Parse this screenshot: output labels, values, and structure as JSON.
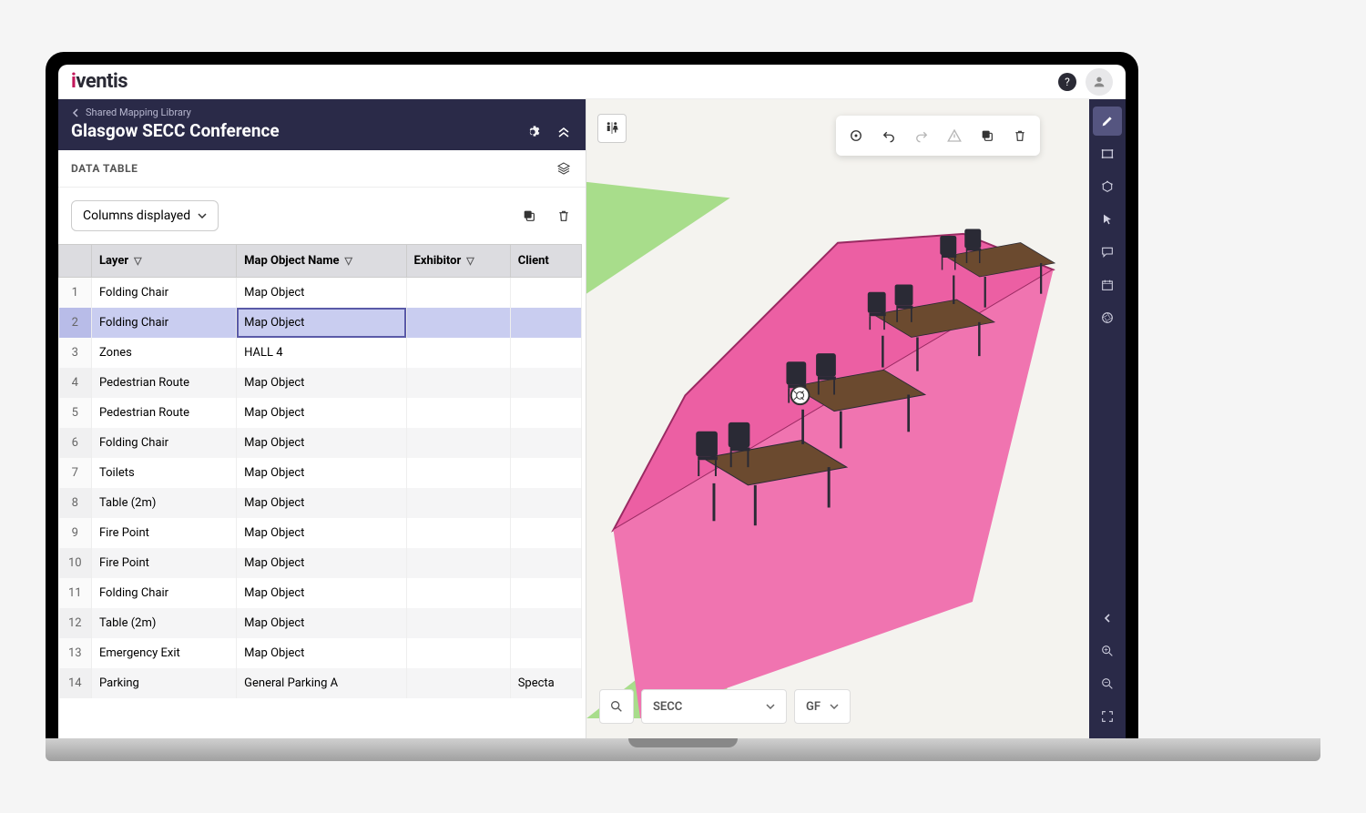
{
  "brand": {
    "i": "i",
    "rest": "ventis"
  },
  "header": {
    "breadcrumb": "Shared Mapping Library",
    "title": "Glasgow SECC Conference",
    "subheader": "DATA TABLE"
  },
  "toolbar": {
    "columns_label": "Columns displayed"
  },
  "columns": {
    "layer": "Layer",
    "obj": "Map Object Name",
    "exhibitor": "Exhibitor",
    "client": "Client"
  },
  "rows": [
    {
      "idx": "1",
      "layer": "Folding Chair",
      "obj": "Map Object",
      "exhibitor": "",
      "client": ""
    },
    {
      "idx": "2",
      "layer": "Folding Chair",
      "obj": "Map Object",
      "exhibitor": "",
      "client": "",
      "selected": true
    },
    {
      "idx": "3",
      "layer": "Zones",
      "obj": "HALL 4",
      "exhibitor": "",
      "client": ""
    },
    {
      "idx": "4",
      "layer": "Pedestrian Route",
      "obj": "Map Object",
      "exhibitor": "",
      "client": ""
    },
    {
      "idx": "5",
      "layer": "Pedestrian Route",
      "obj": "Map Object",
      "exhibitor": "",
      "client": ""
    },
    {
      "idx": "6",
      "layer": "Folding Chair",
      "obj": "Map Object",
      "exhibitor": "",
      "client": ""
    },
    {
      "idx": "7",
      "layer": "Toilets",
      "obj": "Map Object",
      "exhibitor": "",
      "client": ""
    },
    {
      "idx": "8",
      "layer": "Table (2m)",
      "obj": "Map Object",
      "exhibitor": "",
      "client": ""
    },
    {
      "idx": "9",
      "layer": "Fire Point",
      "obj": "Map Object",
      "exhibitor": "",
      "client": ""
    },
    {
      "idx": "10",
      "layer": "Fire Point",
      "obj": "Map Object",
      "exhibitor": "",
      "client": ""
    },
    {
      "idx": "11",
      "layer": "Folding Chair",
      "obj": "Map Object",
      "exhibitor": "",
      "client": ""
    },
    {
      "idx": "12",
      "layer": "Table (2m)",
      "obj": "Map Object",
      "exhibitor": "",
      "client": ""
    },
    {
      "idx": "13",
      "layer": "Emergency Exit",
      "obj": "Map Object",
      "exhibitor": "",
      "client": ""
    },
    {
      "idx": "14",
      "layer": "Parking",
      "obj": "General Parking A",
      "exhibitor": "",
      "client": "Specta"
    }
  ],
  "map": {
    "search": "",
    "location": "SECC",
    "floor": "GF"
  }
}
